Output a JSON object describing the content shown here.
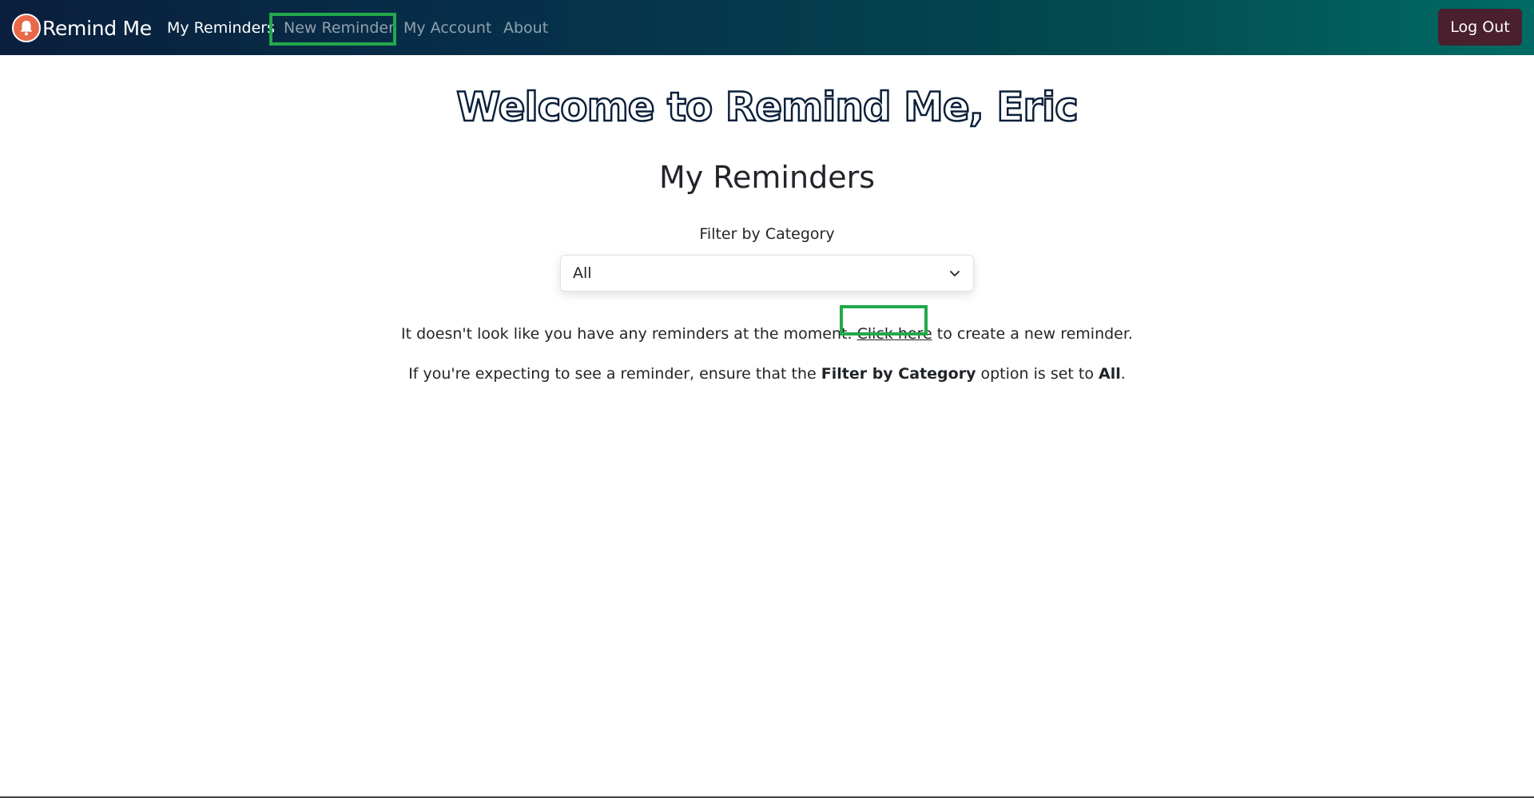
{
  "navbar": {
    "brand": "Remind Me",
    "brand_icon": "bell-icon",
    "links": {
      "my_reminders": "My Reminders",
      "new_reminder": "New Reminder",
      "my_account": "My Account",
      "about": "About"
    },
    "logout": "Log Out",
    "colors": {
      "gradient_start": "#0a1f3d",
      "gradient_end": "#006b64",
      "logout_bg": "#4a1f2e",
      "brand_icon": "#e8694a"
    }
  },
  "main": {
    "welcome": "Welcome to Remind Me, Eric",
    "title": "My Reminders",
    "filter": {
      "label": "Filter by Category",
      "selected": "All"
    },
    "empty_message": {
      "before": "It doesn't look like you have any reminders at the moment. ",
      "link": "Click here",
      "after": " to create a new reminder."
    },
    "hint": {
      "before": "If you're expecting to see a reminder, ensure that the ",
      "bold1": "Filter by Category",
      "middle": " option is set to ",
      "bold2": "All",
      "end": "."
    }
  },
  "highlight_color": "#22a94a"
}
